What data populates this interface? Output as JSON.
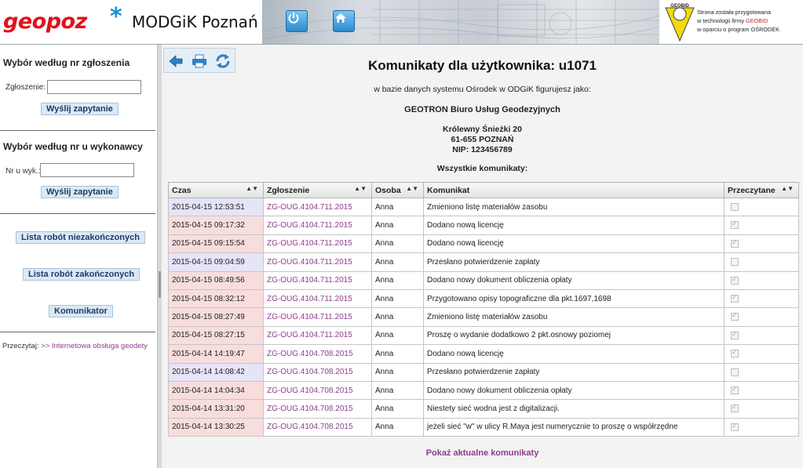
{
  "header": {
    "logo_text": "geopoz",
    "logo_star": "*",
    "app_title": "MODGiK Poznań",
    "power_button": "power-icon",
    "home_button": "home-icon",
    "geobid_logo_text": "GEOBID",
    "geobid_note_1": "Strona została przygotowana",
    "geobid_note_2_prefix": "w technologii firmy ",
    "geobid_note_2_brand": "GEOBID",
    "geobid_note_3": "w oparciu o program OŚRODEK"
  },
  "sidebar": {
    "section1_title": "Wybór według nr zgłoszenia",
    "section1_label": "Zgłoszenie:",
    "section1_value": "",
    "section1_button": "Wyślij zapytanie",
    "section2_title": "Wybór według nr u wykonawcy",
    "section2_label": "Nr u wyk.:",
    "section2_value": "",
    "section2_button": "Wyślij zapytanie",
    "btn_unfinished": "Lista robót niezakończonych",
    "btn_finished": "Lista robót zakończonych",
    "btn_messenger": "Komunikator",
    "footer_prefix": "Przeczytaj:",
    "footer_link": ">> Internetowa obsługa geodety"
  },
  "main": {
    "title": "Komunikaty dla użytkownika: u1071",
    "intro": "w bazie danych systemu Ośrodek w ODGiK figurujesz jako:",
    "company": "GEOTRON Biuro Usług Geodezyjnych",
    "street": "Królewny Śnieżki 20",
    "city": "61-655 POZNAŃ",
    "nip": "NIP: 123456789",
    "all_messages": "Wszystkie komunikaty:",
    "show_current": "Pokaż aktualne komunikaty",
    "columns": [
      "Czas",
      "Zgłoszenie",
      "Osoba",
      "Komunikat",
      "Przeczytane"
    ],
    "rows": [
      {
        "czas": "2015-04-15 12:53:51",
        "zgloszenie": "ZG-OUG.4104.711.2015",
        "osoba": "Anna",
        "komunikat": "Zmieniono listę materiałów zasobu",
        "read": false
      },
      {
        "czas": "2015-04-15 09:17:32",
        "zgloszenie": "ZG-OUG.4104.711.2015",
        "osoba": "Anna",
        "komunikat": "Dodano nową licencję",
        "read": true
      },
      {
        "czas": "2015-04-15 09:15:54",
        "zgloszenie": "ZG-OUG.4104.711.2015",
        "osoba": "Anna",
        "komunikat": "Dodano nową licencję",
        "read": true
      },
      {
        "czas": "2015-04-15 09:04:59",
        "zgloszenie": "ZG-OUG.4104.711.2015",
        "osoba": "Anna",
        "komunikat": "Przesłano potwierdzenie zapłaty",
        "read": false
      },
      {
        "czas": "2015-04-15 08:49:56",
        "zgloszenie": "ZG-OUG.4104.711.2015",
        "osoba": "Anna",
        "komunikat": "Dodano nowy dokument obliczenia opłaty",
        "read": true
      },
      {
        "czas": "2015-04-15 08:32:12",
        "zgloszenie": "ZG-OUG.4104.711.2015",
        "osoba": "Anna",
        "komunikat": "Przygotowano opisy topograficzne dla pkt.1697,1698",
        "read": true
      },
      {
        "czas": "2015-04-15 08:27:49",
        "zgloszenie": "ZG-OUG.4104.711.2015",
        "osoba": "Anna",
        "komunikat": "Zmieniono listę materiałów zasobu",
        "read": true
      },
      {
        "czas": "2015-04-15 08:27:15",
        "zgloszenie": "ZG-OUG.4104.711.2015",
        "osoba": "Anna",
        "komunikat": "Proszę o wydanie dodatkowo 2 pkt.osnowy poziomej",
        "read": true
      },
      {
        "czas": "2015-04-14 14:19:47",
        "zgloszenie": "ZG-OUG.4104.708.2015",
        "osoba": "Anna",
        "komunikat": "Dodano nową licencję",
        "read": true
      },
      {
        "czas": "2015-04-14 14:08:42",
        "zgloszenie": "ZG-OUG.4104.708.2015",
        "osoba": "Anna",
        "komunikat": "Przesłano potwierdzenie zapłaty",
        "read": false
      },
      {
        "czas": "2015-04-14 14:04:34",
        "zgloszenie": "ZG-OUG.4104.708.2015",
        "osoba": "Anna",
        "komunikat": "Dodano nowy dokument obliczenia opłaty",
        "read": true
      },
      {
        "czas": "2015-04-14 13:31:20",
        "zgloszenie": "ZG-OUG.4104.708.2015",
        "osoba": "Anna",
        "komunikat": "Niestety sieć wodna jest z digitalizacji.",
        "read": true
      },
      {
        "czas": "2015-04-14 13:30:25",
        "zgloszenie": "ZG-OUG.4104.708.2015",
        "osoba": "Anna",
        "komunikat": "jeżeli sieć \"w\" w ulicy R.Maya jest numerycznie to proszę o współrzędne",
        "read": true
      }
    ]
  },
  "toolbar": {
    "back_icon": "arrow-left-icon",
    "print_icon": "printer-icon",
    "refresh_icon": "refresh-icon"
  },
  "colors": {
    "brand_red": "#e0101a",
    "brand_blue": "#1a90d8",
    "link_purple": "#8e3d8e",
    "row_unread_time_bg": "#e6e4f7",
    "row_read_time_bg": "#f8dddd"
  }
}
